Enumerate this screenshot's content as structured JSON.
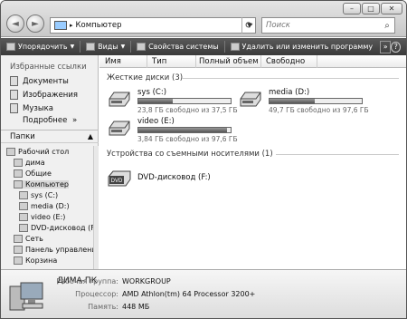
{
  "address": {
    "path": "Компьютер",
    "separator": "▸"
  },
  "search": {
    "placeholder": "Поиск"
  },
  "toolbar": {
    "organize": "Упорядочить",
    "views": "Виды",
    "system_props": "Свойства системы",
    "uninstall": "Удалить или изменить программу",
    "more": "»",
    "help": "?"
  },
  "favorites": {
    "title": "Избранные ссылки",
    "items": [
      "Документы",
      "Изображения",
      "Музыка"
    ],
    "more": "Подробнее",
    "more_chevron": "»"
  },
  "folders": {
    "title": "Папки",
    "tree": [
      "Рабочий стол",
      "дима",
      "Общие",
      "Компьютер",
      "sys (C:)",
      "media (D:)",
      "video (E:)",
      "DVD-дисковод (F:",
      "Сеть",
      "Панель управлени",
      "Корзина"
    ]
  },
  "columns": [
    "Имя",
    "Тип",
    "Полный объем",
    "Свободно"
  ],
  "groups": {
    "hard_drives": "Жесткие диски (3)",
    "removable": "Устройства со съемными носителями (1)"
  },
  "drives": [
    {
      "name": "sys (C:)",
      "free": "23,8 ГБ свободно из 37,5 ГБ",
      "used_fraction": 0.37
    },
    {
      "name": "media (D:)",
      "free": "49,7 ГБ свободно из 97,6 ГБ",
      "used_fraction": 0.49
    },
    {
      "name": "video (E:)",
      "free": "3,84 ГБ свободно из 97,6 ГБ",
      "used_fraction": 0.96
    }
  ],
  "dvd": {
    "name": "DVD-дисковод (F:)",
    "label": "DVD"
  },
  "details": {
    "computer_name": "ДИМА-ПК",
    "workgroup_label": "Рабочая группа:",
    "workgroup": "WORKGROUP",
    "cpu_label": "Процессор:",
    "cpu": "AMD Athlon(tm) 64 Processor 3200+",
    "memory_label": "Память:",
    "memory": "448 МБ"
  }
}
